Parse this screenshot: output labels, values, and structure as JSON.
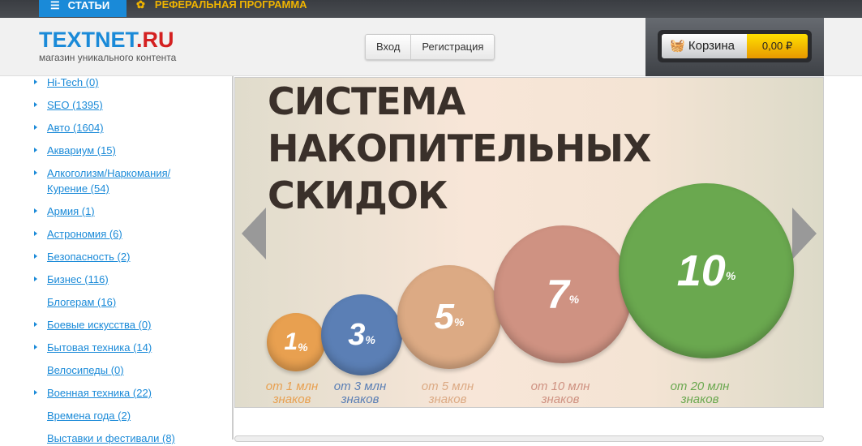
{
  "topnav": {
    "articles": "СТАТЬИ",
    "referral": "РЕФЕРАЛЬНАЯ ПРОГРАММА"
  },
  "header": {
    "logo_main": "TEXTNET",
    "logo_tld": ".RU",
    "tagline": "магазин уникального контента",
    "login": "Вход",
    "register": "Регистрация",
    "cart_label": "Корзина",
    "cart_total": "0,00 ₽"
  },
  "sidebar": {
    "items": [
      {
        "label": "Hi-Tech (0)"
      },
      {
        "label": "SEO (1395)"
      },
      {
        "label": "Авто (1604)"
      },
      {
        "label": "Аквариум (15)"
      },
      {
        "label": "Алкоголизм/Наркомания/ Курение (54)"
      },
      {
        "label": "Армия (1)"
      },
      {
        "label": "Астрономия (6)"
      },
      {
        "label": "Безопасность (2)"
      },
      {
        "label": "Бизнес (116)"
      },
      {
        "label": "Блогерам (16)"
      },
      {
        "label": "Боевые искусства (0)"
      },
      {
        "label": "Бытовая техника (14)"
      },
      {
        "label": "Велосипеды (0)"
      },
      {
        "label": "Военная техника (22)"
      },
      {
        "label": "Времена года (2)"
      },
      {
        "label": "Выставки и фестивали (8)"
      }
    ]
  },
  "banner": {
    "title": "СИСТЕМА НАКОПИТЕЛЬНЫХ СКИДОК",
    "discounts": [
      {
        "value": "1",
        "pct": "%",
        "label1": "от 1 млн",
        "label2": "знаков",
        "color": "#e8a050"
      },
      {
        "value": "3",
        "pct": "%",
        "label1": "от 3 млн",
        "label2": "знаков",
        "color": "#5b7fb5"
      },
      {
        "value": "5",
        "pct": "%",
        "label1": "от 5 млн",
        "label2": "знаков",
        "color": "#dcaa84"
      },
      {
        "value": "7",
        "pct": "%",
        "label1": "от 10 млн",
        "label2": "знаков",
        "color": "#cf9282"
      },
      {
        "value": "10",
        "pct": "%",
        "label1": "от 20 млн",
        "label2": "знаков",
        "color": "#6aa84f"
      }
    ]
  }
}
